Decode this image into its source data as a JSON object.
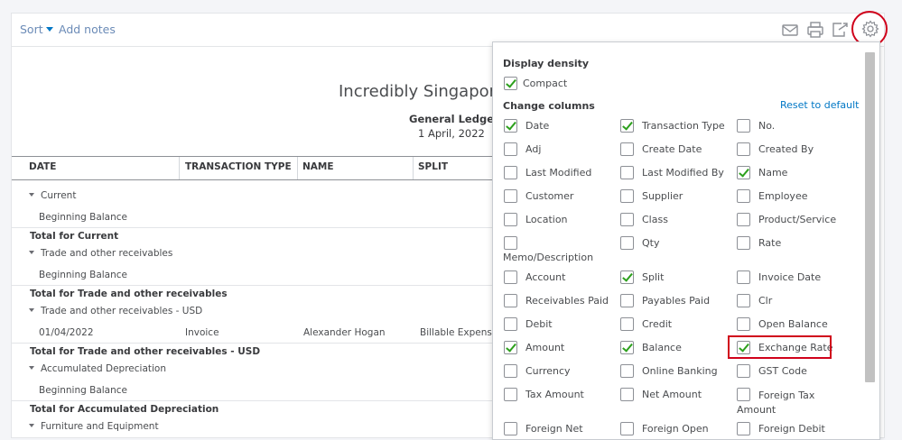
{
  "toolbar": {
    "sort_label": "Sort",
    "add_notes_label": "Add notes"
  },
  "report": {
    "company_name": "Incredibly Singapor",
    "report_name": "General Ledger",
    "date": "1 April, 2022",
    "columns": [
      "DATE",
      "TRANSACTION TYPE",
      "NAME",
      "SPLIT"
    ],
    "rows": [
      {
        "kind": "group",
        "text": "Current"
      },
      {
        "kind": "balance",
        "text": "Beginning Balance"
      },
      {
        "kind": "total",
        "text": "Total for Current"
      },
      {
        "kind": "group",
        "text": "Trade and other receivables"
      },
      {
        "kind": "balance",
        "text": "Beginning Balance"
      },
      {
        "kind": "total",
        "text": "Total for Trade and other receivables"
      },
      {
        "kind": "group",
        "text": "Trade and other receivables - USD"
      },
      {
        "kind": "txn",
        "date": "01/04/2022",
        "type": "Invoice",
        "name": "Alexander Hogan",
        "split": "Billable Expense"
      },
      {
        "kind": "total",
        "text": "Total for Trade and other receivables - USD"
      },
      {
        "kind": "group",
        "text": "Accumulated Depreciation"
      },
      {
        "kind": "balance",
        "text": "Beginning Balance"
      },
      {
        "kind": "total",
        "text": "Total for Accumulated Depreciation"
      },
      {
        "kind": "group",
        "text": "Furniture and Equipment"
      }
    ]
  },
  "settings": {
    "display_density_label": "Display density",
    "compact": {
      "label": "Compact",
      "checked": true
    },
    "change_columns_label": "Change columns",
    "reset_label": "Reset to default",
    "columns": [
      [
        {
          "label": "Date",
          "checked": true
        },
        {
          "label": "Transaction Type",
          "checked": true
        },
        {
          "label": "No.",
          "checked": false
        }
      ],
      [
        {
          "label": "Adj",
          "checked": false
        },
        {
          "label": "Create Date",
          "checked": false
        },
        {
          "label": "Created By",
          "checked": false
        }
      ],
      [
        {
          "label": "Last Modified",
          "checked": false
        },
        {
          "label": "Last Modified By",
          "checked": false
        },
        {
          "label": "Name",
          "checked": true
        }
      ],
      [
        {
          "label": "Customer",
          "checked": false
        },
        {
          "label": "Supplier",
          "checked": false
        },
        {
          "label": "Employee",
          "checked": false
        }
      ],
      [
        {
          "label": "Location",
          "checked": false
        },
        {
          "label": "Class",
          "checked": false
        },
        {
          "label": "Product/Service",
          "checked": false
        }
      ],
      [
        {
          "label": "Memo/Description",
          "checked": false
        },
        {
          "label": "Qty",
          "checked": false
        },
        {
          "label": "Rate",
          "checked": false
        }
      ],
      [
        {
          "label": "Account",
          "checked": false
        },
        {
          "label": "Split",
          "checked": true
        },
        {
          "label": "Invoice Date",
          "checked": false
        }
      ],
      [
        {
          "label": "Receivables Paid",
          "checked": false
        },
        {
          "label": "Payables Paid",
          "checked": false
        },
        {
          "label": "Clr",
          "checked": false
        }
      ],
      [
        {
          "label": "Debit",
          "checked": false
        },
        {
          "label": "Credit",
          "checked": false
        },
        {
          "label": "Open Balance",
          "checked": false
        }
      ],
      [
        {
          "label": "Amount",
          "checked": true
        },
        {
          "label": "Balance",
          "checked": true
        },
        {
          "label": "Exchange Rate",
          "checked": true
        }
      ],
      [
        {
          "label": "Currency",
          "checked": false
        },
        {
          "label": "Online Banking",
          "checked": false
        },
        {
          "label": "GST Code",
          "checked": false
        }
      ],
      [
        {
          "label": "Tax Amount",
          "checked": false
        },
        {
          "label": "Net Amount",
          "checked": false
        },
        {
          "label": "Foreign Tax Amount",
          "checked": false
        }
      ],
      [
        {
          "label": "Foreign Net",
          "checked": false
        },
        {
          "label": "Foreign Open",
          "checked": false
        },
        {
          "label": "Foreign Debit",
          "checked": false
        }
      ]
    ]
  },
  "icons": [
    "email-icon",
    "print-icon",
    "export-icon",
    "gear-icon"
  ],
  "colors": {
    "link": "#0077c5",
    "check": "#2ca01c",
    "highlight": "#d0021b"
  }
}
